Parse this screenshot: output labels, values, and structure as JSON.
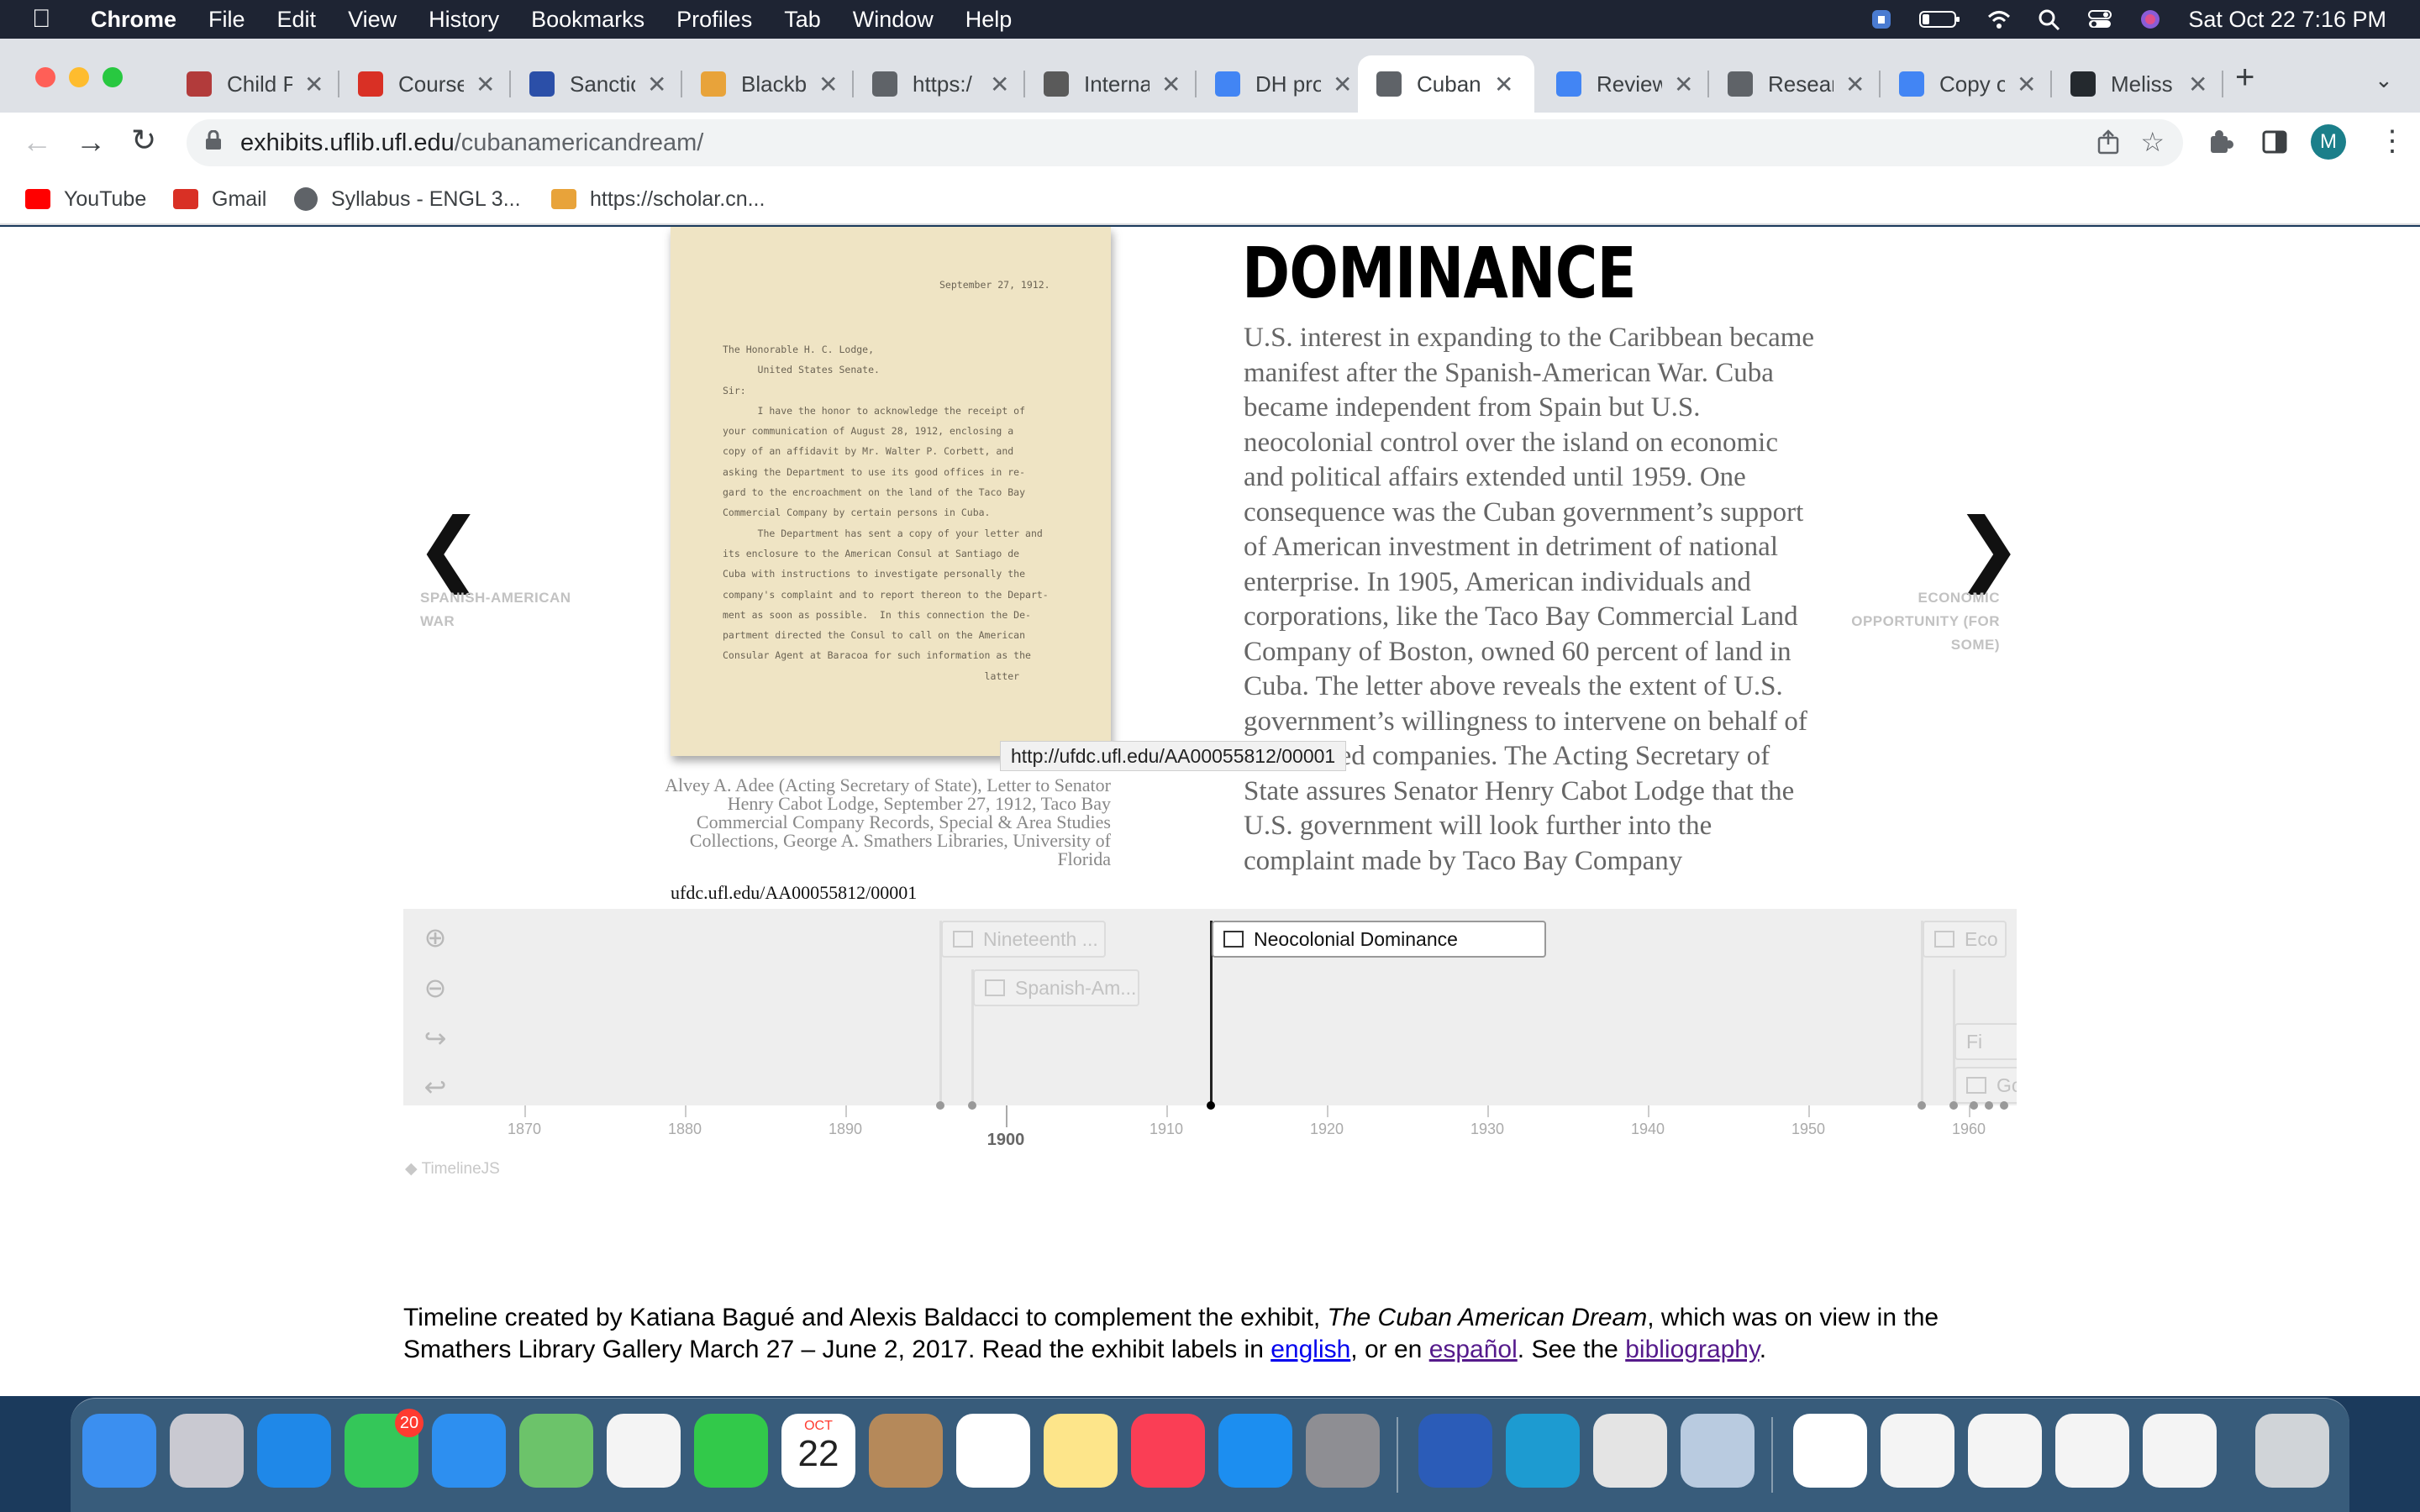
{
  "menubar": {
    "app": "Chrome",
    "items": [
      "File",
      "Edit",
      "View",
      "History",
      "Bookmarks",
      "Profiles",
      "Tab",
      "Window",
      "Help"
    ],
    "clock": "Sat Oct 22  7:16 PM"
  },
  "tabs": [
    {
      "label": "Child P",
      "color": "#b23b3b"
    },
    {
      "label": "Course",
      "color": "#d93025"
    },
    {
      "label": "Sanctio",
      "color": "#2b4fa8"
    },
    {
      "label": "Blackb",
      "color": "#e8a33a"
    },
    {
      "label": "https:/",
      "color": "#5f6368"
    },
    {
      "label": "Interna",
      "color": "#5a5a5a"
    },
    {
      "label": "DH pro",
      "color": "#4285f4"
    },
    {
      "label": "Cuban",
      "color": "#5f6368",
      "active": true
    },
    {
      "label": "Review",
      "color": "#4285f4"
    },
    {
      "label": "Resear",
      "color": "#5f6368"
    },
    {
      "label": "Copy o",
      "color": "#4285f4"
    },
    {
      "label": "Meliss",
      "color": "#24292e"
    }
  ],
  "address": {
    "domain": "exhibits.uflib.ufl.edu",
    "path": "/cubanamericandream/"
  },
  "bookmarks": [
    {
      "label": "YouTube",
      "color": "#ff0000"
    },
    {
      "label": "Gmail",
      "color": "#d93025"
    },
    {
      "label": "Syllabus - ENGL 3...",
      "color": "#5f6368"
    },
    {
      "label": "https://scholar.cn...",
      "color": "#e8a33a"
    }
  ],
  "slide": {
    "prev_label": "SPANISH-AMERICAN WAR",
    "next_label": "ECONOMIC OPPORTUNITY (FOR SOME)",
    "headline": "DOMINANCE",
    "body": "U.S. interest in expanding to the Caribbean became manifest after the Spanish-American War. Cuba became independent from Spain but U.S. neocolonial control over the island on economic and political affairs extended until 1959. One consequence was the Cuban government’s support of American investment in detriment of national enterprise. In 1905, American individuals and corporations, like the Taco Bay Commercial Land Company of Boston, owned 60 percent of land in Cuba. The letter above reveals the extent of U.S. government’s willingness to intervene on behalf of U.S.-based companies. The Acting Secretary of State assures Senator Henry Cabot Lodge that the U.S. government will look further into the complaint made by Taco Bay Company",
    "letter_date": "September 27, 1912.",
    "letter_body": "The Honorable H. C. Lodge,\n      United States Senate.\nSir:\n      I have the honor to acknowledge the receipt of\nyour communication of August 28, 1912, enclosing a\ncopy of an affidavit by Mr. Walter P. Corbett, and\nasking the Department to use its good offices in re-\ngard to the encroachment on the land of the Taco Bay\nCommercial Company by certain persons in Cuba.\n      The Department has sent a copy of your letter and\nits enclosure to the American Consul at Santiago de\nCuba with instructions to investigate personally the\ncompany's complaint and to report thereon to the Depart-\nment as soon as possible.  In this connection the De-\npartment directed the Consul to call on the American\nConsular Agent at Baracoa for such information as the\n                                             latter",
    "caption": "Alvey A. Adee (Acting Secretary of State), Letter to Senator Henry Cabot Lodge, September 27, 1912, Taco Bay Commercial Company Records, Special & Area Studies Collections, George A. Smathers Libraries, University of Florida",
    "credit_url": "ufdc.ufl.edu/AA00055812/00001",
    "tooltip": "http://ufdc.ufl.edu/AA00055812/00001"
  },
  "timeline": {
    "events": [
      {
        "label": "Nineteenth ...",
        "active": false
      },
      {
        "label": "Spanish-Am...",
        "active": false
      },
      {
        "label": "Neocolonial Dominance",
        "active": true
      },
      {
        "label": "Eco",
        "active": false
      },
      {
        "label": "Fi",
        "active": false
      },
      {
        "label": "Go",
        "active": false
      }
    ],
    "ticks": [
      "1870",
      "1880",
      "1890",
      "1900",
      "1910",
      "1920",
      "1930",
      "1940",
      "1950",
      "1960"
    ],
    "brand": "TimelineJS"
  },
  "footer": {
    "part1": "Timeline created by Katiana Bagué and Alexis Baldacci to complement the exhibit, ",
    "exhibit": "The Cuban American Dream",
    "part2": ", which was on view in the Smathers Library Gallery March 27 – June 2, 2017. Read the exhibit labels in ",
    "link_english": "english",
    "part3": ", or en ",
    "link_espanol": "español",
    "part4": ". See the ",
    "link_bib": "bibliography",
    "part5": "."
  },
  "dock": {
    "messages_badge": "20",
    "calendar_month": "OCT",
    "calendar_day": "22",
    "apps": [
      "finder",
      "launchpad",
      "safari",
      "messages",
      "mail",
      "maps",
      "photos",
      "facetime",
      "calendar",
      "contacts",
      "reminders",
      "notes",
      "music",
      "app-store",
      "system-preferences",
      "word",
      "edge",
      "chrome",
      "preview",
      "qr",
      "doc1",
      "doc2",
      "doc3",
      "doc4",
      "trash"
    ]
  }
}
